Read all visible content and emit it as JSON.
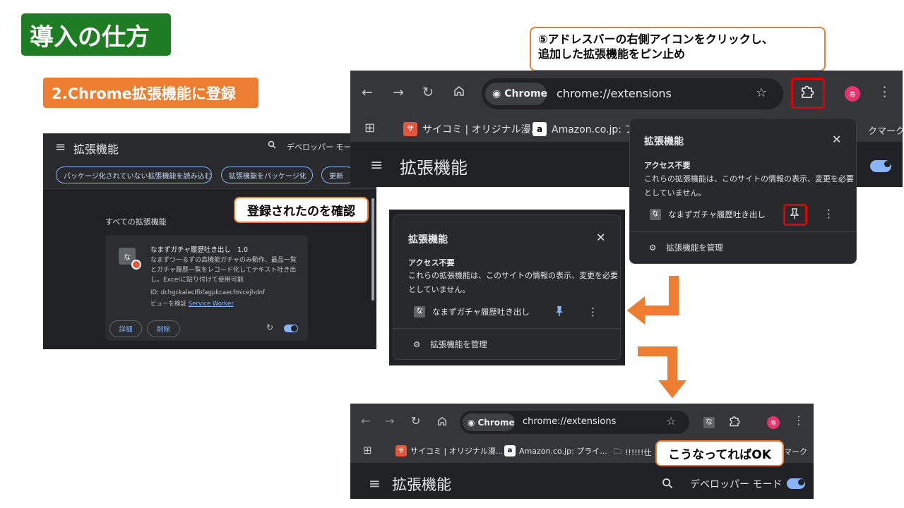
{
  "slide": {
    "title": "導入の仕方",
    "step": "2.Chrome拡張機能に登録",
    "callout_top": [
      "⑤アドレスバーの右側アイコンをクリックし、",
      "追加した拡張機能をピン止め"
    ],
    "callout_mid": "登録されたのを確認",
    "callout_bottom": "こうなってればOK",
    "colors": {
      "title_bg": "#1e7c22",
      "step_bg": "#ed7d31",
      "arrow": "#ed7d31",
      "highlight": "#e00000"
    }
  },
  "ext_page": {
    "menu_icon": "hamburger-icon",
    "title": "拡張機能",
    "search_icon": "search-icon",
    "dev_mode": "デベロッパー モード",
    "buttons": [
      "パッケージ化されていない拡張機能を読み込む",
      "拡張機能をパッケージ化",
      "更新"
    ],
    "section": "すべての拡張機能",
    "card": {
      "icon_letter": "な",
      "name": "なまずガチャ履歴吐き出し",
      "version": "1.0",
      "description": "なまずつーるずの高機能ガチャのみ動作、最品一覧とガチャ履歴一覧をレコード化してテキスト吐き出し。Excelに貼り付けて使用可能",
      "id": "ID: dchgckalecIfbfagpkcaecfmicejhdnf",
      "view_label": "ビューを検証",
      "view_link": "Service Worker",
      "details": "詳細",
      "remove": "削除",
      "enabled": true
    }
  },
  "browser_top": {
    "chip": "Chrome",
    "url": "chrome://extensions",
    "avatar": "寿",
    "bookmarks": [
      "サイコミ | オリジナル漫...",
      "Amazon.co.jp: プ"
    ],
    "bookmark_tail": "クマーク",
    "page_title": "拡張機能"
  },
  "popup": {
    "title": "拡張機能",
    "subtitle": "アクセス不要",
    "text": "これらの拡張機能は、このサイトの情報の表示、変更を必要としていません。",
    "ext_letter": "な",
    "ext_name": "なまずガチャ履歴吐き出し",
    "manage": "拡張機能を管理",
    "pin_state_top": "unpinned",
    "pin_state_mid": "pinned"
  },
  "browser_bottom": {
    "chip": "Chrome",
    "url": "chrome://extensions",
    "avatar": "寿",
    "ext_letter": "な",
    "bookmarks": [
      "サイコミ | オリジナル漫...",
      "Amazon.co.jp: プライ...",
      "!!!!!!仕"
    ],
    "bookmark_tail": "マーク",
    "page_title": "拡張機能",
    "dev_mode": "デベロッパー モード"
  }
}
